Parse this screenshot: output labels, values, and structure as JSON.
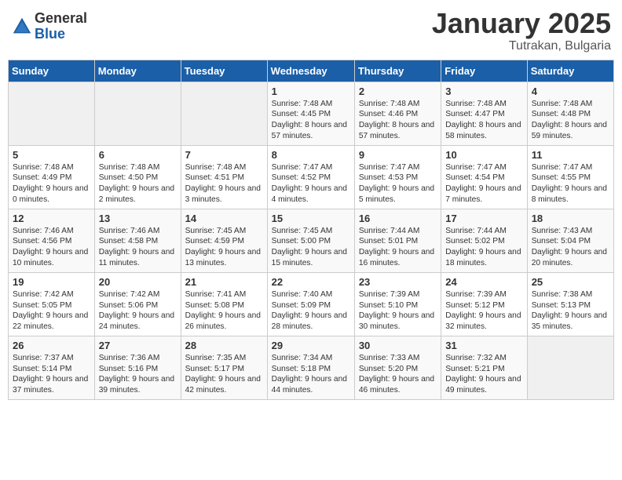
{
  "logo": {
    "general": "General",
    "blue": "Blue"
  },
  "header": {
    "title": "January 2025",
    "location": "Tutrakan, Bulgaria"
  },
  "weekdays": [
    "Sunday",
    "Monday",
    "Tuesday",
    "Wednesday",
    "Thursday",
    "Friday",
    "Saturday"
  ],
  "weeks": [
    [
      {
        "day": "",
        "content": ""
      },
      {
        "day": "",
        "content": ""
      },
      {
        "day": "",
        "content": ""
      },
      {
        "day": "1",
        "content": "Sunrise: 7:48 AM\nSunset: 4:45 PM\nDaylight: 8 hours\nand 57 minutes."
      },
      {
        "day": "2",
        "content": "Sunrise: 7:48 AM\nSunset: 4:46 PM\nDaylight: 8 hours\nand 57 minutes."
      },
      {
        "day": "3",
        "content": "Sunrise: 7:48 AM\nSunset: 4:47 PM\nDaylight: 8 hours\nand 58 minutes."
      },
      {
        "day": "4",
        "content": "Sunrise: 7:48 AM\nSunset: 4:48 PM\nDaylight: 8 hours\nand 59 minutes."
      }
    ],
    [
      {
        "day": "5",
        "content": "Sunrise: 7:48 AM\nSunset: 4:49 PM\nDaylight: 9 hours\nand 0 minutes."
      },
      {
        "day": "6",
        "content": "Sunrise: 7:48 AM\nSunset: 4:50 PM\nDaylight: 9 hours\nand 2 minutes."
      },
      {
        "day": "7",
        "content": "Sunrise: 7:48 AM\nSunset: 4:51 PM\nDaylight: 9 hours\nand 3 minutes."
      },
      {
        "day": "8",
        "content": "Sunrise: 7:47 AM\nSunset: 4:52 PM\nDaylight: 9 hours\nand 4 minutes."
      },
      {
        "day": "9",
        "content": "Sunrise: 7:47 AM\nSunset: 4:53 PM\nDaylight: 9 hours\nand 5 minutes."
      },
      {
        "day": "10",
        "content": "Sunrise: 7:47 AM\nSunset: 4:54 PM\nDaylight: 9 hours\nand 7 minutes."
      },
      {
        "day": "11",
        "content": "Sunrise: 7:47 AM\nSunset: 4:55 PM\nDaylight: 9 hours\nand 8 minutes."
      }
    ],
    [
      {
        "day": "12",
        "content": "Sunrise: 7:46 AM\nSunset: 4:56 PM\nDaylight: 9 hours\nand 10 minutes."
      },
      {
        "day": "13",
        "content": "Sunrise: 7:46 AM\nSunset: 4:58 PM\nDaylight: 9 hours\nand 11 minutes."
      },
      {
        "day": "14",
        "content": "Sunrise: 7:45 AM\nSunset: 4:59 PM\nDaylight: 9 hours\nand 13 minutes."
      },
      {
        "day": "15",
        "content": "Sunrise: 7:45 AM\nSunset: 5:00 PM\nDaylight: 9 hours\nand 15 minutes."
      },
      {
        "day": "16",
        "content": "Sunrise: 7:44 AM\nSunset: 5:01 PM\nDaylight: 9 hours\nand 16 minutes."
      },
      {
        "day": "17",
        "content": "Sunrise: 7:44 AM\nSunset: 5:02 PM\nDaylight: 9 hours\nand 18 minutes."
      },
      {
        "day": "18",
        "content": "Sunrise: 7:43 AM\nSunset: 5:04 PM\nDaylight: 9 hours\nand 20 minutes."
      }
    ],
    [
      {
        "day": "19",
        "content": "Sunrise: 7:42 AM\nSunset: 5:05 PM\nDaylight: 9 hours\nand 22 minutes."
      },
      {
        "day": "20",
        "content": "Sunrise: 7:42 AM\nSunset: 5:06 PM\nDaylight: 9 hours\nand 24 minutes."
      },
      {
        "day": "21",
        "content": "Sunrise: 7:41 AM\nSunset: 5:08 PM\nDaylight: 9 hours\nand 26 minutes."
      },
      {
        "day": "22",
        "content": "Sunrise: 7:40 AM\nSunset: 5:09 PM\nDaylight: 9 hours\nand 28 minutes."
      },
      {
        "day": "23",
        "content": "Sunrise: 7:39 AM\nSunset: 5:10 PM\nDaylight: 9 hours\nand 30 minutes."
      },
      {
        "day": "24",
        "content": "Sunrise: 7:39 AM\nSunset: 5:12 PM\nDaylight: 9 hours\nand 32 minutes."
      },
      {
        "day": "25",
        "content": "Sunrise: 7:38 AM\nSunset: 5:13 PM\nDaylight: 9 hours\nand 35 minutes."
      }
    ],
    [
      {
        "day": "26",
        "content": "Sunrise: 7:37 AM\nSunset: 5:14 PM\nDaylight: 9 hours\nand 37 minutes."
      },
      {
        "day": "27",
        "content": "Sunrise: 7:36 AM\nSunset: 5:16 PM\nDaylight: 9 hours\nand 39 minutes."
      },
      {
        "day": "28",
        "content": "Sunrise: 7:35 AM\nSunset: 5:17 PM\nDaylight: 9 hours\nand 42 minutes."
      },
      {
        "day": "29",
        "content": "Sunrise: 7:34 AM\nSunset: 5:18 PM\nDaylight: 9 hours\nand 44 minutes."
      },
      {
        "day": "30",
        "content": "Sunrise: 7:33 AM\nSunset: 5:20 PM\nDaylight: 9 hours\nand 46 minutes."
      },
      {
        "day": "31",
        "content": "Sunrise: 7:32 AM\nSunset: 5:21 PM\nDaylight: 9 hours\nand 49 minutes."
      },
      {
        "day": "",
        "content": ""
      }
    ]
  ]
}
